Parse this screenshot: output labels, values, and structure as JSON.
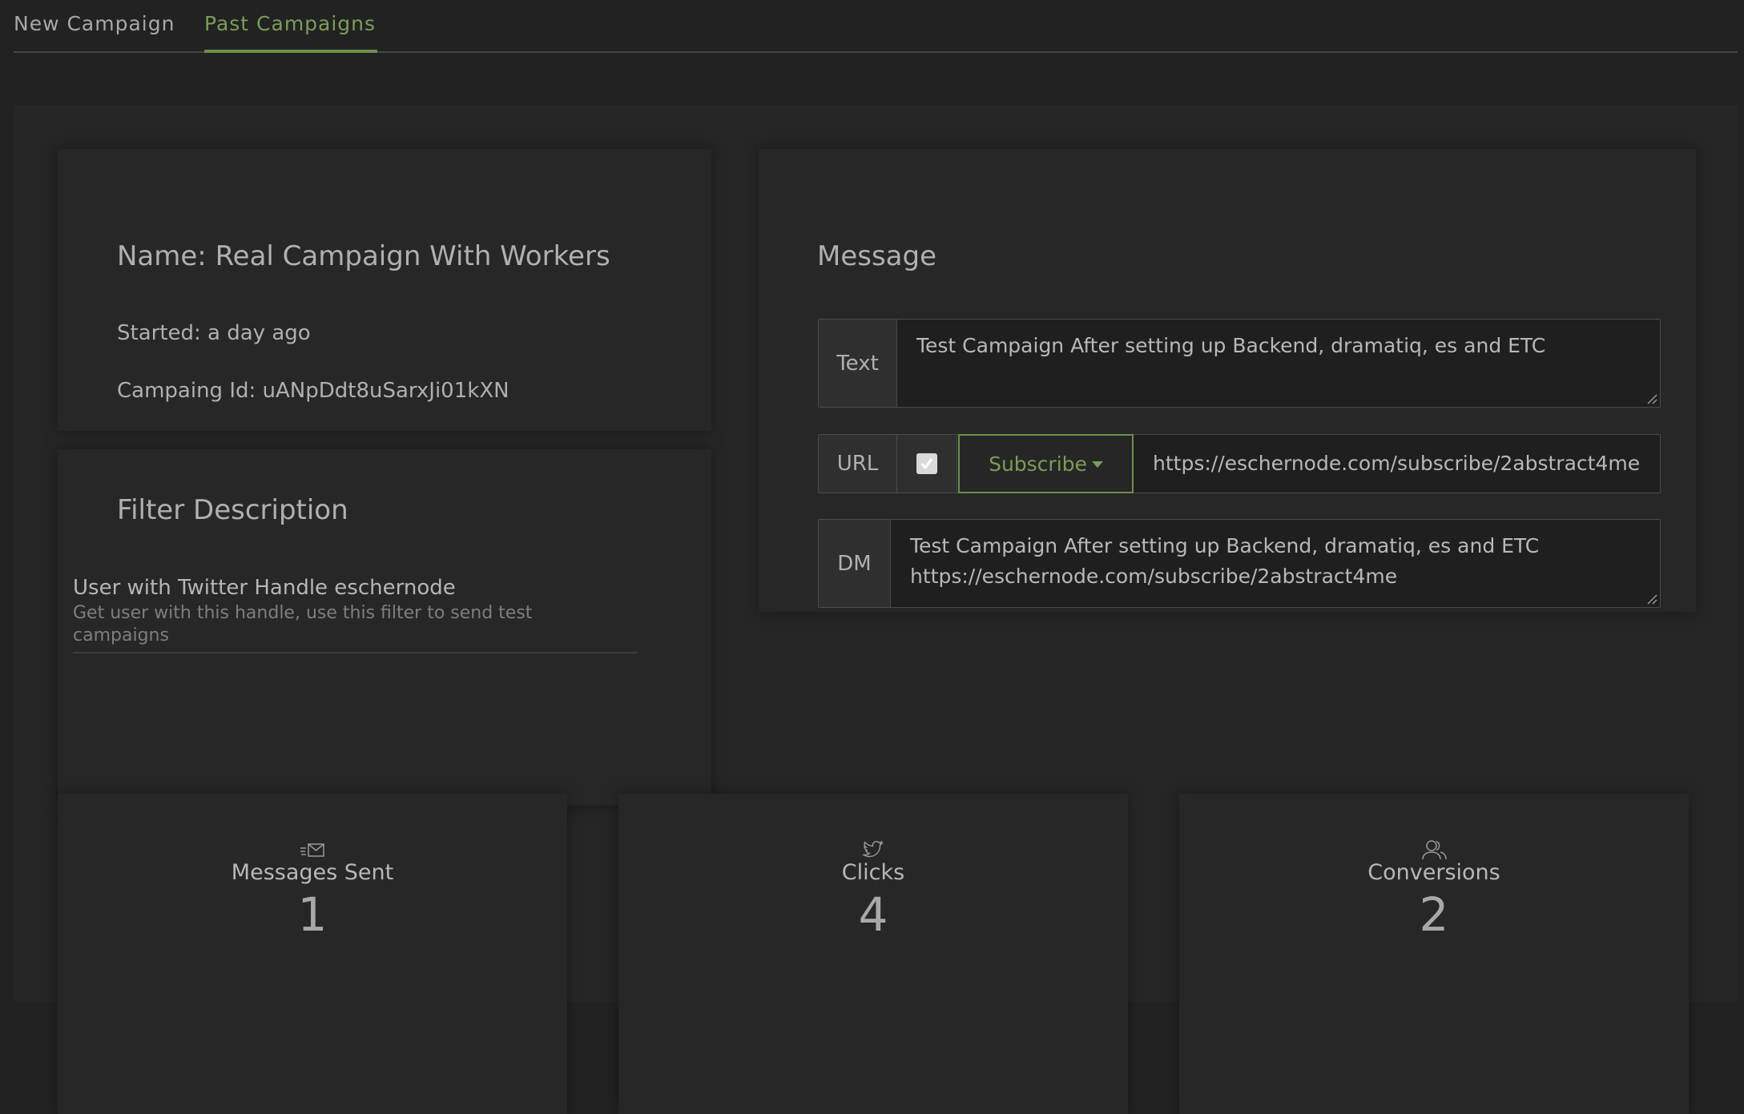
{
  "tabs": [
    {
      "label": "New Campaign",
      "active": false
    },
    {
      "label": "Past Campaigns",
      "active": true
    }
  ],
  "campaign": {
    "name_label": "Name: Real Campaign With Workers",
    "started": "Started: a day ago",
    "id": "Campaing Id: uANpDdt8uSarxJi01kXN"
  },
  "filter": {
    "heading": "Filter Description",
    "title": "User with Twitter Handle eschernode",
    "description": "Get user with this handle, use this filter to send test campaigns"
  },
  "message": {
    "heading": "Message",
    "text_label": "Text",
    "text_value": "Test Campaign After setting up Backend, dramatiq, es and ETC",
    "url_label": "URL",
    "url_checked": true,
    "url_type": "Subscribe",
    "url_value": "https://eschernode.com/subscribe/2abstract4me",
    "dm_label": "DM",
    "dm_value": "Test Campaign After setting up Backend, dramatiq, es and ETC\nhttps://eschernode.com/subscribe/2abstract4me"
  },
  "stats": [
    {
      "label": "Messages Sent",
      "value": "1",
      "icon": "messages-icon"
    },
    {
      "label": "Clicks",
      "value": "4",
      "icon": "twitter-bird-icon"
    },
    {
      "label": "Conversions",
      "value": "2",
      "icon": "users-icon"
    }
  ],
  "colors": {
    "accent": "#7a9d57",
    "background": "#222222",
    "card": "#272727"
  }
}
